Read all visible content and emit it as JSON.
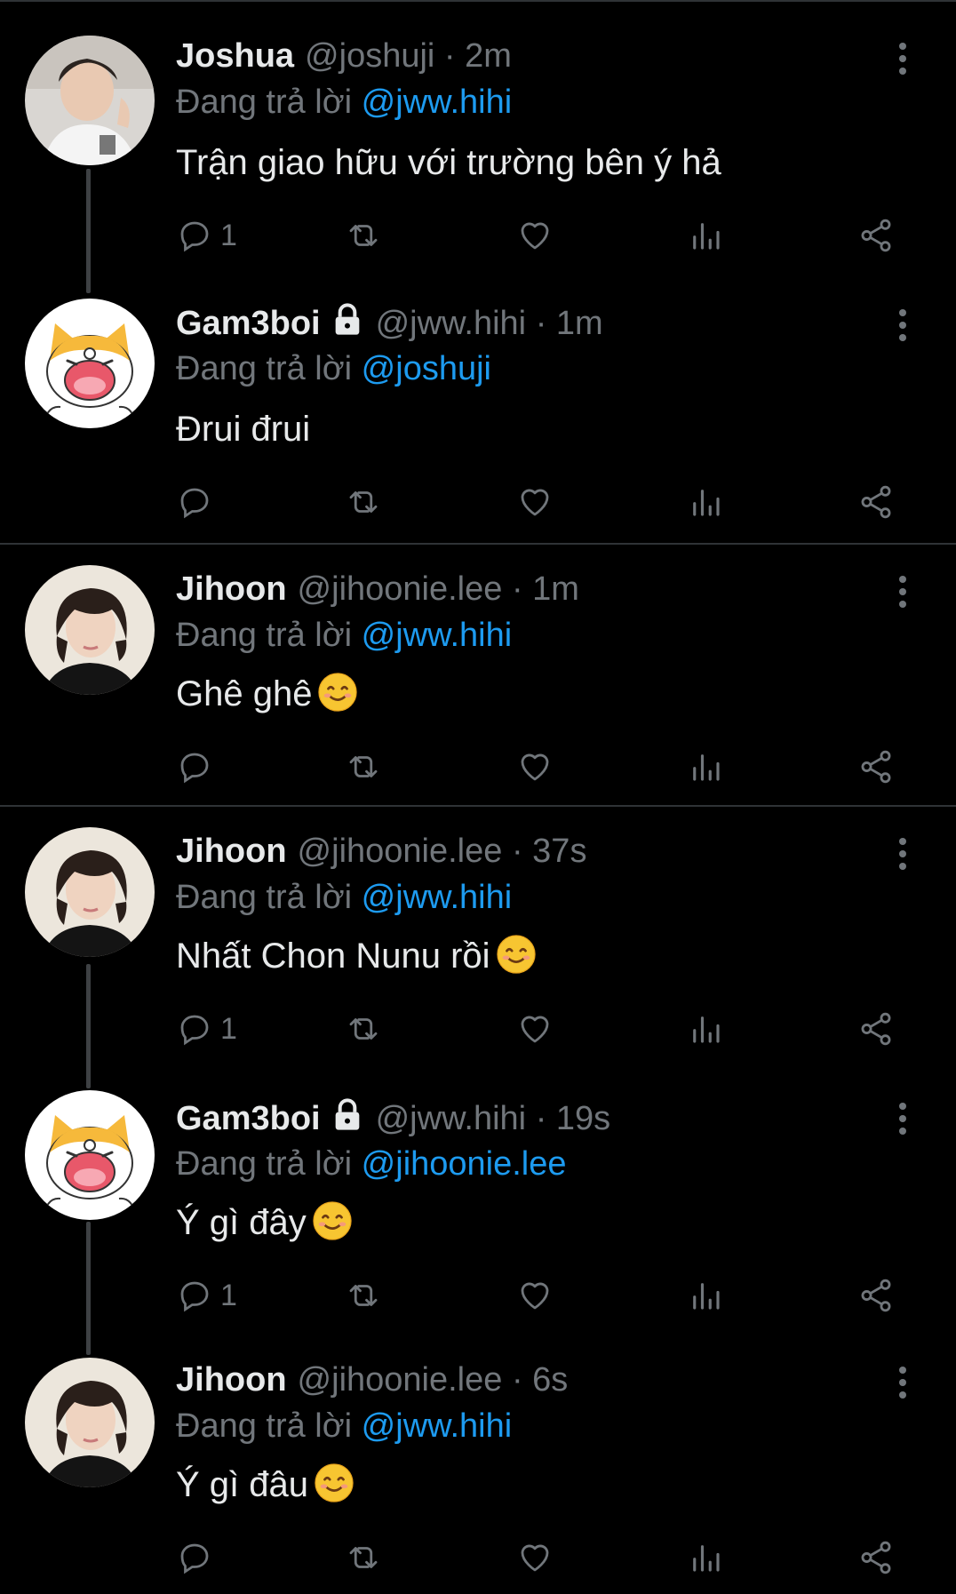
{
  "replying_prefix": "Đang trả lời",
  "tweets": [
    {
      "name": "Joshua",
      "handle": "@joshuji",
      "sep": "·",
      "time": "2m",
      "replying_to": "@jww.hihi",
      "text": "Trận giao hữu với trường bên ý hả",
      "has_emoji": false,
      "reply_count": "1",
      "locked": false,
      "avatar": "photo-joshua"
    },
    {
      "name": "Gam3boi",
      "handle": "@jww.hihi",
      "sep": "·",
      "time": "1m",
      "replying_to": "@joshuji",
      "text": "Đrui đrui",
      "has_emoji": false,
      "reply_count": "",
      "locked": true,
      "avatar": "cartoon-cat"
    },
    {
      "name": "Jihoon",
      "handle": "@jihoonie.lee",
      "sep": "·",
      "time": "1m",
      "replying_to": "@jww.hihi",
      "text": "Ghê ghê",
      "has_emoji": true,
      "reply_count": "",
      "locked": false,
      "avatar": "photo-jihoon"
    },
    {
      "name": "Jihoon",
      "handle": "@jihoonie.lee",
      "sep": "·",
      "time": "37s",
      "replying_to": "@jww.hihi",
      "text": "Nhất Chon Nunu rồi",
      "has_emoji": true,
      "reply_count": "1",
      "locked": false,
      "avatar": "photo-jihoon"
    },
    {
      "name": "Gam3boi",
      "handle": "@jww.hihi",
      "sep": "·",
      "time": "19s",
      "replying_to": "@jihoonie.lee",
      "text": "Ý gì đây",
      "has_emoji": true,
      "reply_count": "1",
      "locked": true,
      "avatar": "cartoon-cat"
    },
    {
      "name": "Jihoon",
      "handle": "@jihoonie.lee",
      "sep": "·",
      "time": "6s",
      "replying_to": "@jww.hihi",
      "text": "Ý gì đâu",
      "has_emoji": true,
      "reply_count": "",
      "locked": false,
      "avatar": "photo-jihoon"
    }
  ],
  "icons": {
    "reply": "reply-icon",
    "retweet": "retweet-icon",
    "like": "heart-icon",
    "views": "views-icon",
    "share": "share-icon",
    "more": "more-vertical-icon",
    "lock": "lock-icon",
    "emoji": "smiling-face-emoji"
  },
  "colors": {
    "background": "#000000",
    "text": "#e7e9ea",
    "muted": "#71767b",
    "link": "#1d9bf0",
    "divider": "#2f3336"
  }
}
